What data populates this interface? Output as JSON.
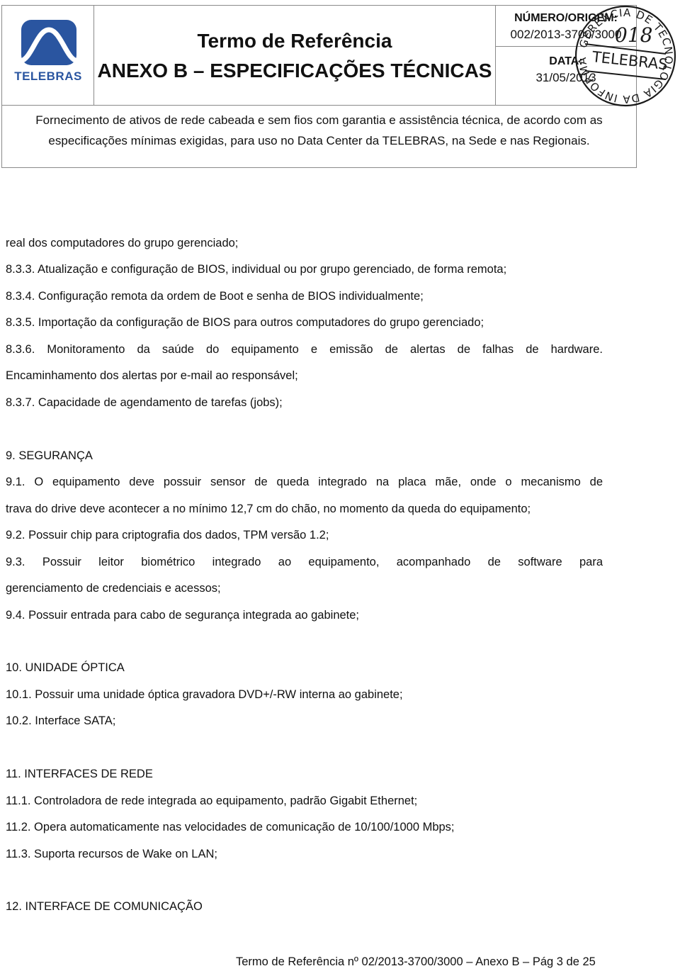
{
  "header": {
    "logo_text": "TELEBRAS",
    "title_line1": "Termo de Referência",
    "title_line2": "ANEXO B – ESPECIFICAÇÕES TÉCNICAS",
    "number_label": "NÚMERO/ORIGEM:",
    "number_value": "002/2013-3700/3000",
    "date_label": "DATA:",
    "date_value": "31/05/2013",
    "description": "Fornecimento de ativos de rede cabeada e sem fios com garantia e assistência técnica, de acordo com as especificações mínimas exigidas, para uso no Data Center da TELEBRAS, na Sede e nas Regionais."
  },
  "stamp": {
    "ring_text": "GERÊNCIA DE TECNOLOGIA DA INFORMAÇÃO",
    "center_text": "TELEBRAS",
    "handwritten_number": "018",
    "color": "#1a1a1a"
  },
  "content": {
    "lines": [
      "real dos computadores do grupo gerenciado;",
      "8.3.3. Atualização e configuração de BIOS, individual ou por grupo gerenciado, de forma remota;",
      "8.3.4. Configuração remota da ordem de Boot e senha de BIOS individualmente;",
      "8.3.5. Importação da configuração de BIOS para outros computadores do grupo gerenciado;",
      "8.3.6. Monitoramento da saúde do equipamento e emissão de alertas de falhas de hardware.",
      "Encaminhamento dos alertas por e-mail ao responsável;",
      "8.3.7. Capacidade de agendamento de tarefas (jobs);",
      "9. SEGURANÇA",
      "9.1. O equipamento deve possuir sensor de queda integrado na placa mãe, onde o mecanismo de",
      "trava do drive deve acontecer a no mínimo 12,7 cm do chão, no momento da queda do equipamento;",
      "9.2. Possuir chip para criptografia dos dados, TPM versão 1.2;",
      "9.3. Possuir leitor biométrico integrado ao equipamento, acompanhado de software para",
      "gerenciamento de credenciais e acessos;",
      "9.4. Possuir entrada para cabo de segurança integrada ao gabinete;",
      "10. UNIDADE ÓPTICA",
      "10.1.  Possuir uma unidade óptica gravadora DVD+/-RW interna ao gabinete;",
      "10.2. Interface SATA;",
      "11.  INTERFACES DE REDE",
      "11.1. Controladora de rede integrada ao equipamento, padrão Gigabit Ethernet;",
      "11.2. Opera automaticamente nas velocidades de comunicação de 10/100/1000 Mbps;",
      "11.3. Suporta recursos de Wake on LAN;",
      "12.  INTERFACE DE COMUNICAÇÃO"
    ]
  },
  "footer": {
    "text": "Termo de Referência nº 02/2013-3700/3000 – Anexo B – Pág 3 de 25"
  },
  "colors": {
    "brand_blue": "#2a55a0",
    "border_gray": "#8a8a8a",
    "text": "#111111"
  }
}
